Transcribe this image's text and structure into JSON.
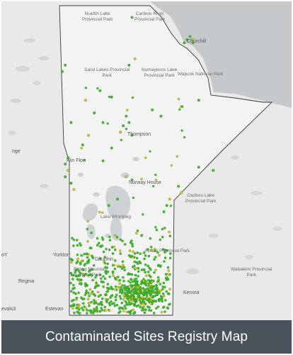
{
  "title": "Contaminated Sites Registry Map",
  "colors": {
    "land": "#e9e9e9",
    "province": "#f2f2f2",
    "water": "#c6c9cc",
    "border": "#3a3a3a",
    "site_green": "#3fbf2a",
    "site_yellow": "#e8c21a",
    "caption_bg": "#4a525c"
  },
  "labels": {
    "nueltin": "Nueltin Lake\nProvincial Park",
    "caribou": "Caribou River\nProvincial Park",
    "churchill": "Churchill",
    "sand_lakes": "Sand Lakes Provincial\nPark",
    "numaykoos": "Numaykoos Lake\nProvincial Park",
    "wapusk": "Wapusk National Park",
    "thompson": "Thompson",
    "flin_flon": "Flin Flon",
    "norway_house": "Norway House",
    "nge": "nge",
    "caribou_prov": "Caribou Lake\nProvincial Park",
    "lake_winnipeg": "Lake Winnipeg",
    "atikaki": "Atikaki Provincial Park",
    "dauphin": "Dauphin",
    "yorkton": "Yorkton",
    "riding_mountain": "Riding Mountain\nNational Park",
    "regina": "Regina",
    "wabakimi": "Wabakimi Provincial\nPark",
    "kenora": "Kenora",
    "estevan": "Estevan",
    "evals": "evals3",
    "oy": "oY"
  },
  "sites": {
    "north_clusters": [
      [
        0.65,
        0.11
      ],
      [
        0.64,
        0.12
      ],
      [
        0.66,
        0.12
      ],
      [
        0.63,
        0.13
      ],
      [
        0.66,
        0.13
      ],
      [
        0.45,
        0.05
      ],
      [
        0.46,
        0.18
      ],
      [
        0.44,
        0.2
      ],
      [
        0.22,
        0.2
      ],
      [
        0.21,
        0.22
      ]
    ],
    "mid_clusters": [
      [
        0.43,
        0.36
      ],
      [
        0.44,
        0.38
      ],
      [
        0.42,
        0.39
      ],
      [
        0.41,
        0.41
      ],
      [
        0.45,
        0.42
      ],
      [
        0.23,
        0.49
      ],
      [
        0.22,
        0.51
      ],
      [
        0.23,
        0.53
      ],
      [
        0.22,
        0.55
      ],
      [
        0.24,
        0.57
      ],
      [
        0.25,
        0.59
      ],
      [
        0.43,
        0.55
      ],
      [
        0.45,
        0.56
      ],
      [
        0.61,
        0.58
      ],
      [
        0.62,
        0.6
      ],
      [
        0.68,
        0.52
      ],
      [
        0.73,
        0.53
      ],
      [
        0.58,
        0.62
      ],
      [
        0.57,
        0.64
      ],
      [
        0.56,
        0.66
      ],
      [
        0.32,
        0.35
      ],
      [
        0.35,
        0.38
      ],
      [
        0.3,
        0.42
      ],
      [
        0.28,
        0.45
      ],
      [
        0.38,
        0.46
      ],
      [
        0.35,
        0.5
      ],
      [
        0.52,
        0.34
      ],
      [
        0.55,
        0.36
      ],
      [
        0.62,
        0.33
      ],
      [
        0.68,
        0.31
      ],
      [
        0.34,
        0.28
      ],
      [
        0.38,
        0.3
      ],
      [
        0.29,
        0.31
      ],
      [
        0.24,
        0.38
      ],
      [
        0.4,
        0.62
      ],
      [
        0.37,
        0.64
      ]
    ]
  }
}
